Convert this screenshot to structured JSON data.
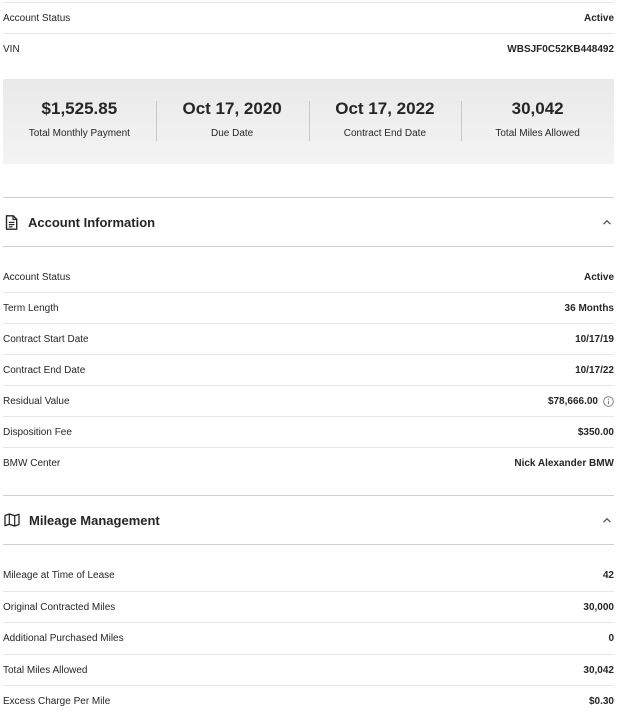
{
  "top_rows": [
    {
      "label": "Account Status",
      "value": "Active"
    },
    {
      "label": "VIN",
      "value": "WBSJF0C52KB448492"
    }
  ],
  "summary": [
    {
      "value": "$1,525.85",
      "label": "Total Monthly Payment"
    },
    {
      "value": "Oct 17, 2020",
      "label": "Due Date"
    },
    {
      "value": "Oct 17, 2022",
      "label": "Contract End Date"
    },
    {
      "value": "30,042",
      "label": "Total Miles Allowed"
    }
  ],
  "account_info": {
    "title": "Account Information",
    "icon": "document-icon",
    "rows": [
      {
        "label": "Account Status",
        "value": "Active"
      },
      {
        "label": "Term Length",
        "value": "36 Months"
      },
      {
        "label": "Contract Start Date",
        "value": "10/17/19"
      },
      {
        "label": "Contract End Date",
        "value": "10/17/22"
      },
      {
        "label": "Residual Value",
        "value": "$78,666.00"
      },
      {
        "label": "Disposition Fee",
        "value": "$350.00"
      },
      {
        "label": "BMW Center",
        "value": "Nick Alexander BMW"
      }
    ]
  },
  "mileage": {
    "title": "Mileage Management",
    "icon": "map-icon",
    "rows": [
      {
        "label": "Mileage at Time of Lease",
        "value": "42"
      },
      {
        "label": "Original Contracted Miles",
        "value": "30,000"
      },
      {
        "label": "Additional Purchased Miles",
        "value": "0"
      },
      {
        "label": "Total Miles Allowed",
        "value": "30,042"
      },
      {
        "label": "Excess Charge Per Mile",
        "value": "$0.30"
      }
    ]
  },
  "colors": {
    "text": "#262626",
    "divider": "#e6e6e6",
    "card_bg": "#eeeeee"
  }
}
